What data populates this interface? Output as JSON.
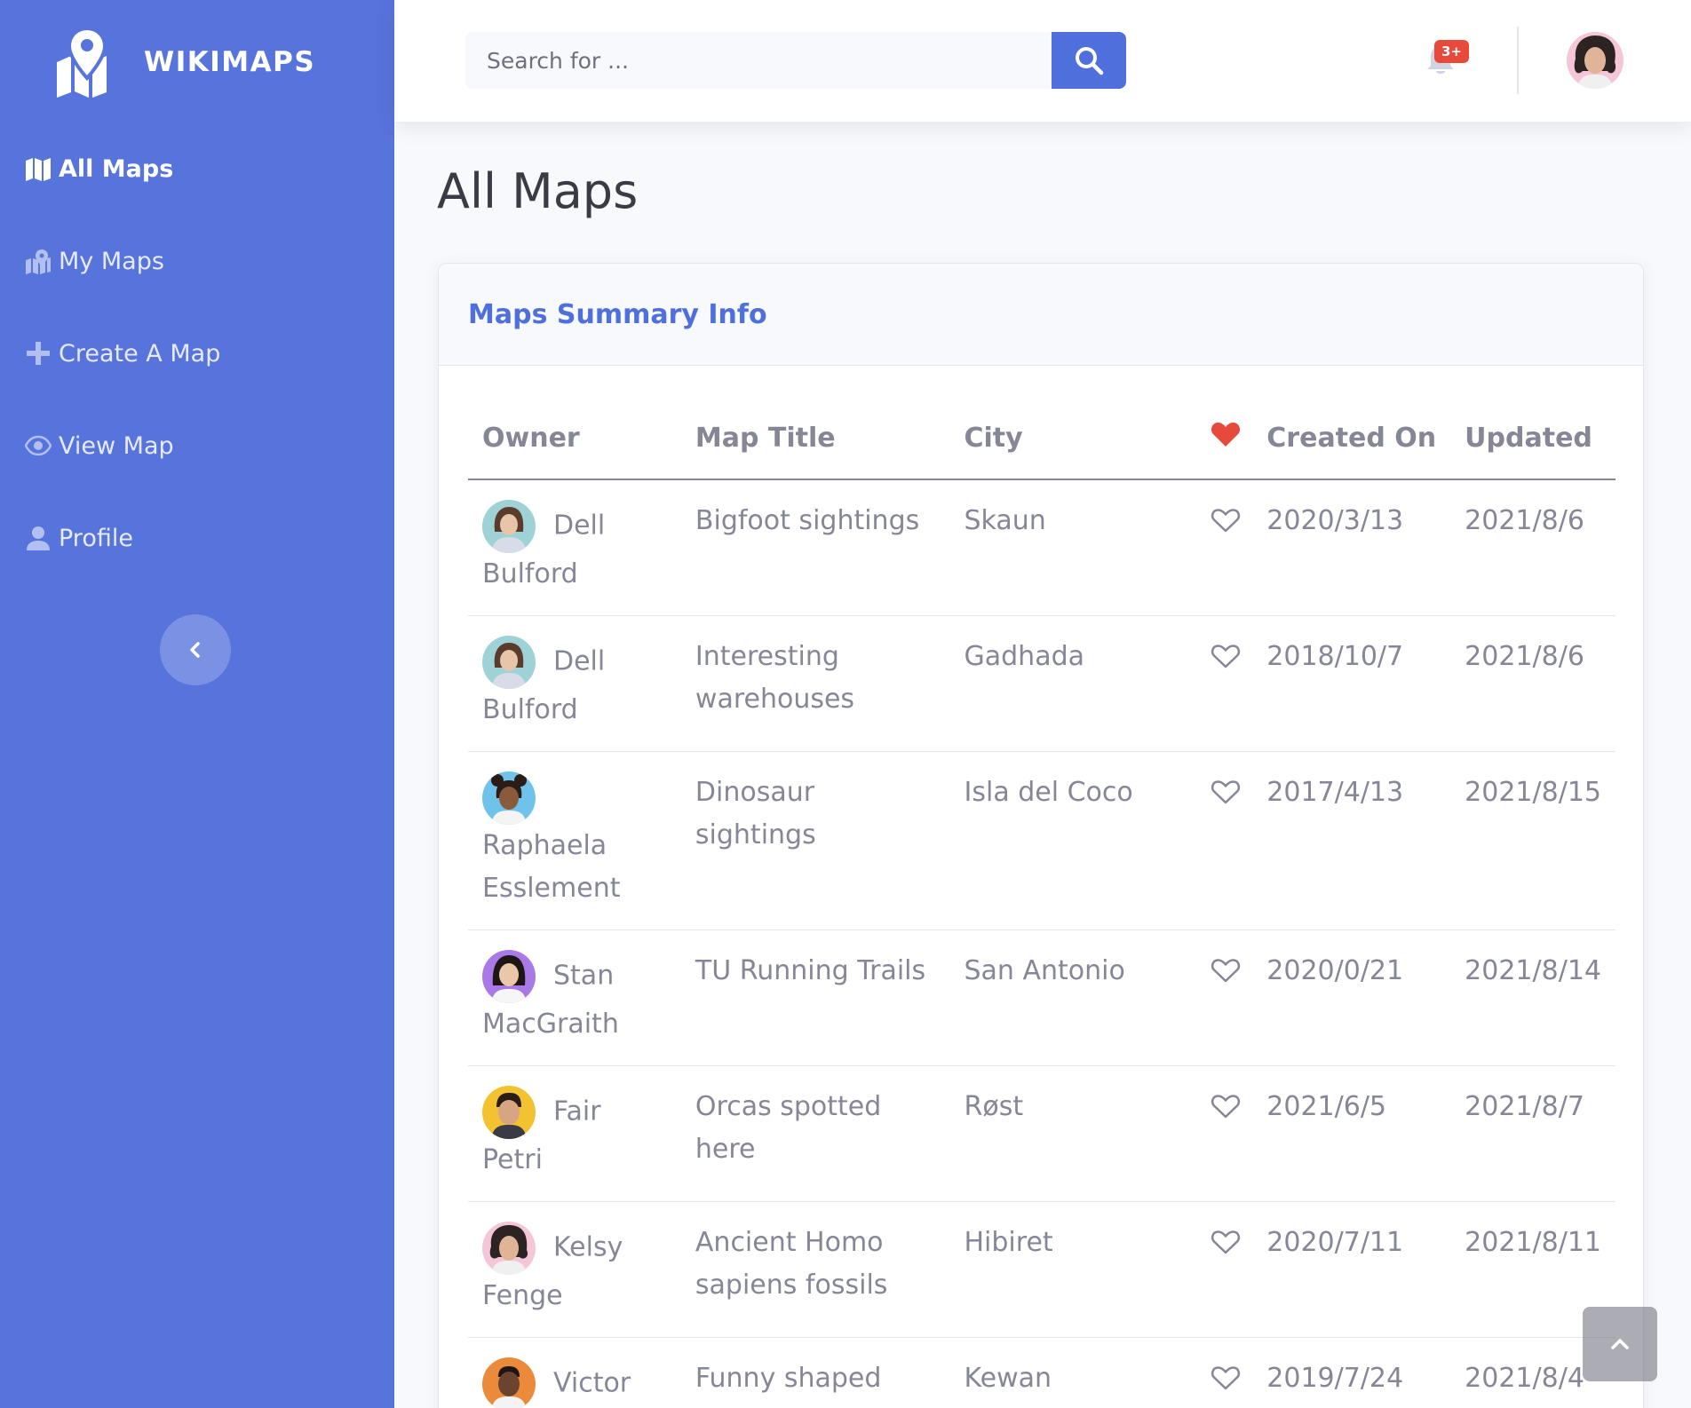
{
  "brand": {
    "name": "WIKIMAPS"
  },
  "sidebar": {
    "items": [
      {
        "label": "All Maps",
        "icon": "map-icon",
        "active": true
      },
      {
        "label": "My Maps",
        "icon": "map-marked-icon",
        "active": false
      },
      {
        "label": "Create A Map",
        "icon": "plus-icon",
        "active": false
      },
      {
        "label": "View Map",
        "icon": "eye-icon",
        "active": false
      },
      {
        "label": "Profile",
        "icon": "user-icon",
        "active": false
      }
    ],
    "collapse_icon": "chevron-left-icon"
  },
  "topbar": {
    "search_placeholder": "Search for ...",
    "search_icon": "search-icon",
    "notification_count": "3+",
    "notification_icon": "bell-icon"
  },
  "page": {
    "title": "All Maps"
  },
  "card": {
    "title": "Maps Summary Info",
    "columns": [
      "Owner",
      "Map Title",
      "City",
      "",
      "Created On",
      "Updated"
    ],
    "favorite_column_icon": "heart-icon",
    "rows": [
      {
        "owner": "Dell Bulford",
        "title": "Bigfoot sightings",
        "city": "Skaun",
        "created": "2020/3/13",
        "updated": "2021/8/6"
      },
      {
        "owner": "Dell Bulford",
        "title": "Interesting warehouses",
        "city": "Gadhada",
        "created": "2018/10/7",
        "updated": "2021/8/6"
      },
      {
        "owner": "Raphaela Esslement",
        "title": "Dinosaur sightings",
        "city": "Isla del Coco",
        "created": "2017/4/13",
        "updated": "2021/8/15"
      },
      {
        "owner": "Stan MacGraith",
        "title": "TU Running Trails",
        "city": "San Antonio",
        "created": "2020/0/21",
        "updated": "2021/8/14"
      },
      {
        "owner": "Fair Petri",
        "title": "Orcas spotted here",
        "city": "Røst",
        "created": "2021/6/5",
        "updated": "2021/8/7"
      },
      {
        "owner": "Kelsy Fenge",
        "title": "Ancient Homo sapiens fossils",
        "city": "Hibiret",
        "created": "2020/7/11",
        "updated": "2021/8/11"
      },
      {
        "owner": "Victor Wimbush",
        "title": "Funny shaped dunes",
        "city": "Kewan",
        "created": "2019/7/24",
        "updated": "2021/8/4"
      }
    ]
  },
  "colors": {
    "sidebar": "#5773dc",
    "primary": "#4e6fdc",
    "danger": "#e74a3b",
    "text": "#858796"
  },
  "scroll_top_icon": "chevron-up-icon"
}
